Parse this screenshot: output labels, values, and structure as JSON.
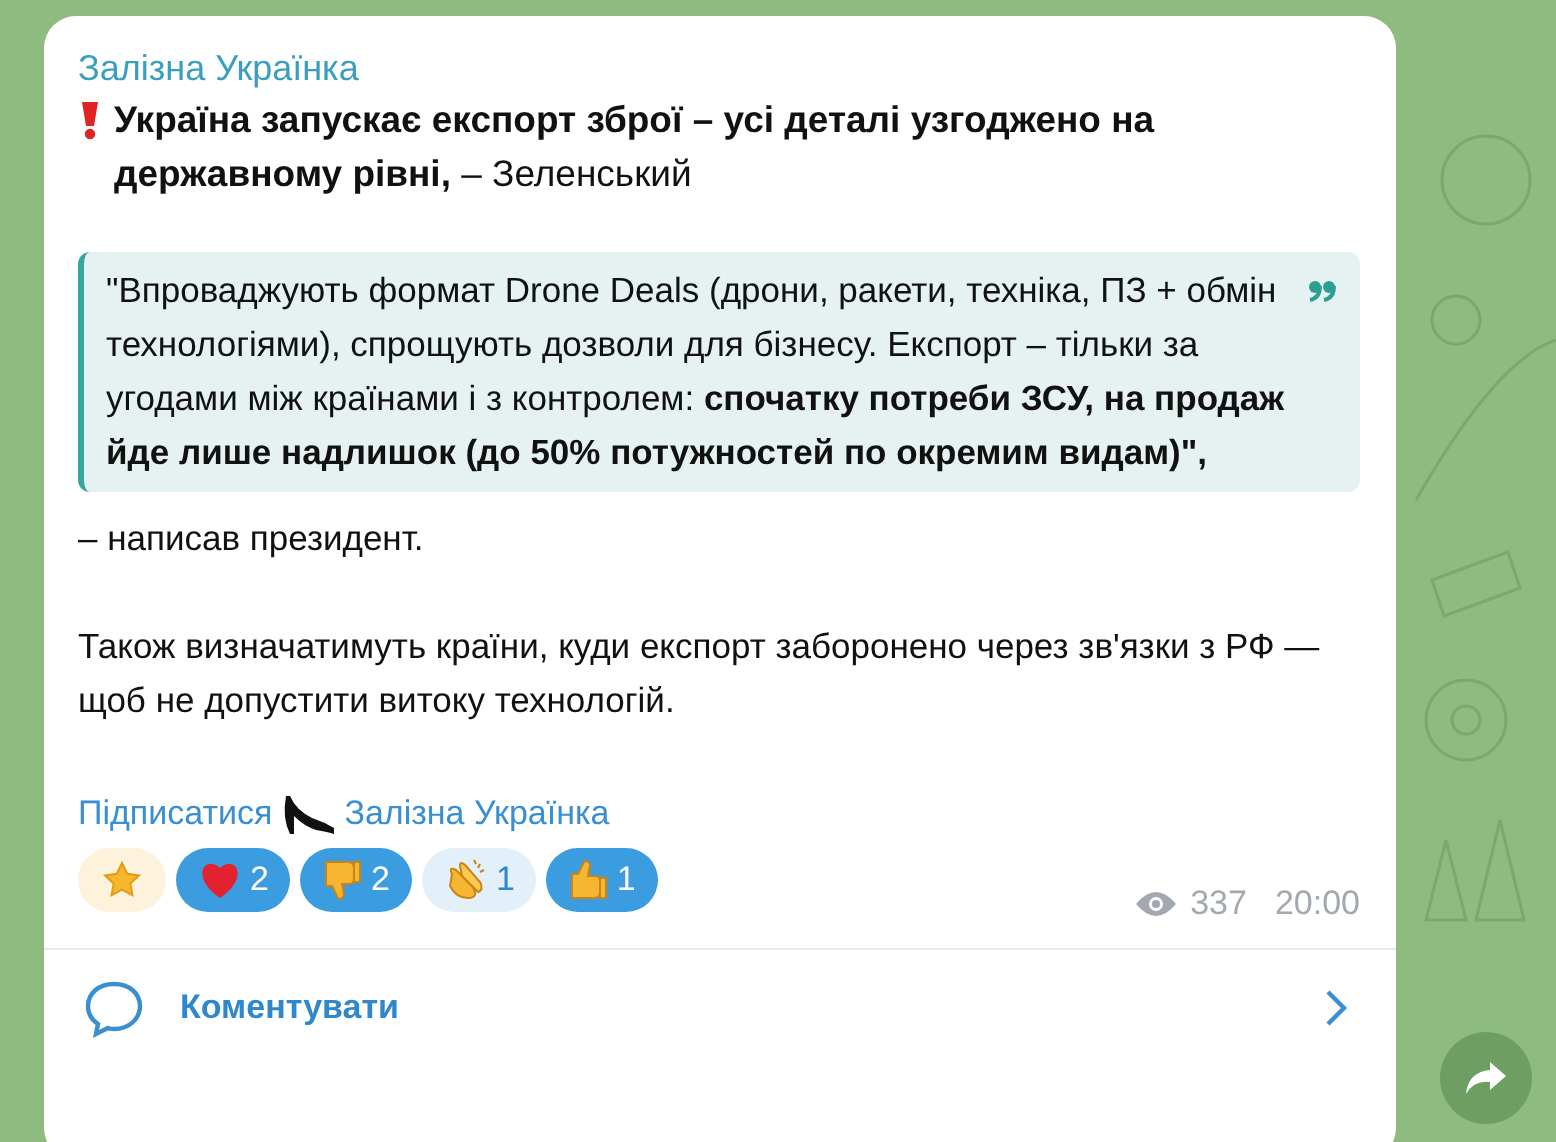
{
  "channel": {
    "name": "Залізна Українка"
  },
  "headline": "**Україна запускає експорт зброї – усі деталі узгоджено на державному рівні,** – Зеленський",
  "quote": "\"Впроваджують формат Drone Deals (дрони, ракети, техніка, ПЗ + обмін технологіями), спрощують дозволи для бізнесу. Експорт – тільки за угодами між країнами і з контролем: **спочатку потреби ЗСУ, на продаж йде лише надлишок (до 50% потужностей по окремим видам)\",**",
  "paragraphs": [
    "– написав президент.",
    "Також визначатимуть країни, куди експорт заборонено через зв'язки з РФ — щоб не допустити витоку технологій."
  ],
  "signature": {
    "link_1": "Підписатися",
    "link_2": "Залізна Українка"
  },
  "reactions": [
    {
      "kind": "star"
    },
    {
      "kind": "heart",
      "count": "2",
      "selected": true
    },
    {
      "kind": "thumbs-down",
      "count": "2",
      "selected": true
    },
    {
      "kind": "clap",
      "count": "1",
      "selected": false
    },
    {
      "kind": "thumbs-up",
      "count": "1",
      "selected": true
    }
  ],
  "meta": {
    "views": "337",
    "time": "20:00"
  },
  "comments": {
    "label": "Коментувати"
  }
}
